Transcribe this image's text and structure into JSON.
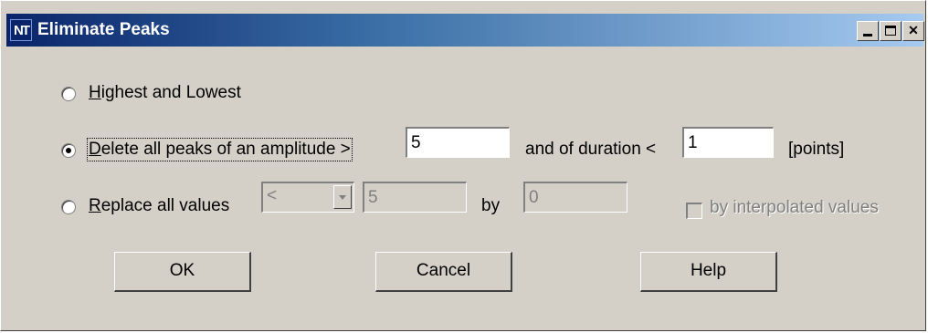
{
  "window": {
    "title": "Eliminate Peaks",
    "icon": "app-logo-icon"
  },
  "options": {
    "highest_lowest": {
      "accel": "H",
      "rest": "ighest and Lowest",
      "selected": false
    },
    "delete_peaks": {
      "accel": "D",
      "rest": "elete all peaks of an amplitude >",
      "selected": true,
      "amplitude_value": "5",
      "duration_label": "and of duration <",
      "duration_value": "1",
      "unit_label": "[points]"
    },
    "replace_values": {
      "accel": "R",
      "rest": "eplace all values",
      "selected": false,
      "operator": "<",
      "threshold_value": "5",
      "by_label": "by",
      "by_value": "0",
      "interp_label": "by interpolated values",
      "interp_checked": false
    }
  },
  "buttons": {
    "ok": "OK",
    "cancel": "Cancel",
    "help": "Help"
  }
}
